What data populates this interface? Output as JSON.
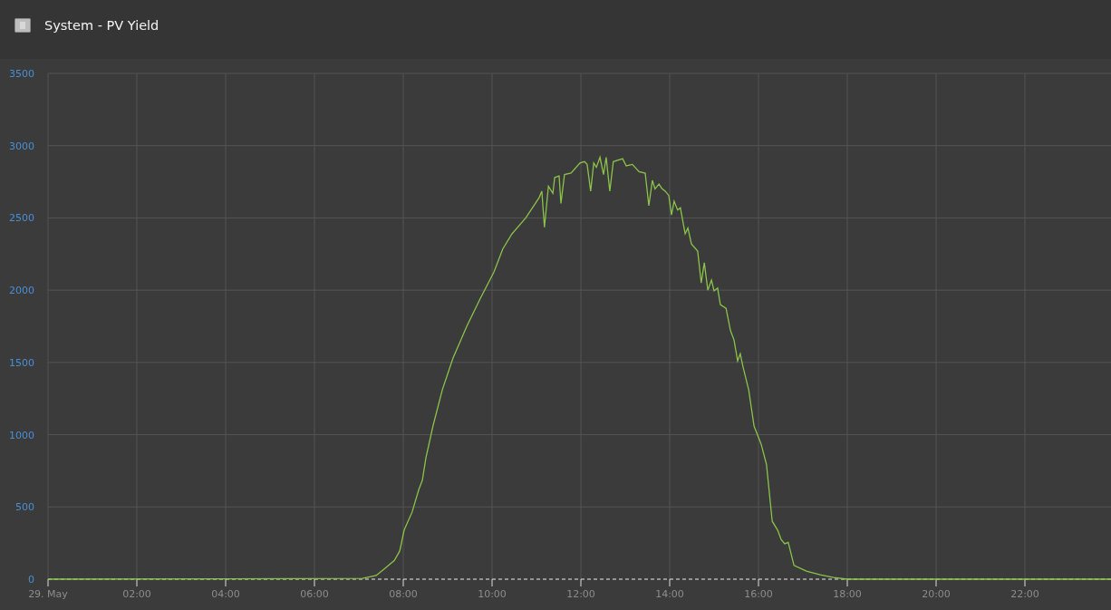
{
  "window": {
    "title": "System - PV Yield"
  },
  "chart": {
    "chart_data": {
      "type": "line",
      "xlim": [
        0,
        24
      ],
      "ylim": [
        0,
        3500
      ],
      "xticks": [
        {
          "value": 0,
          "label": "29. May"
        },
        {
          "value": 2,
          "label": "02:00"
        },
        {
          "value": 4,
          "label": "04:00"
        },
        {
          "value": 6,
          "label": "06:00"
        },
        {
          "value": 8,
          "label": "08:00"
        },
        {
          "value": 10,
          "label": "10:00"
        },
        {
          "value": 12,
          "label": "12:00"
        },
        {
          "value": 14,
          "label": "14:00"
        },
        {
          "value": 16,
          "label": "16:00"
        },
        {
          "value": 18,
          "label": "18:00"
        },
        {
          "value": 20,
          "label": "20:00"
        },
        {
          "value": 22,
          "label": "22:00"
        }
      ],
      "yticks": [
        0,
        500,
        1000,
        1500,
        2000,
        2500,
        3000,
        3500
      ],
      "x": [
        0,
        7.08,
        7.39,
        7.59,
        7.8,
        7.92,
        8.02,
        8.2,
        8.35,
        8.43,
        8.51,
        8.67,
        8.88,
        9.12,
        9.43,
        9.73,
        10.04,
        10.24,
        10.45,
        10.76,
        11.06,
        11.12,
        11.18,
        11.27,
        11.37,
        11.41,
        11.51,
        11.55,
        11.63,
        11.78,
        11.98,
        12.08,
        12.14,
        12.22,
        12.29,
        12.35,
        12.43,
        12.51,
        12.57,
        12.65,
        12.73,
        12.94,
        13.02,
        13.16,
        13.31,
        13.45,
        13.53,
        13.61,
        13.67,
        13.76,
        13.82,
        13.9,
        13.98,
        14.04,
        14.1,
        14.18,
        14.24,
        14.35,
        14.41,
        14.49,
        14.63,
        14.71,
        14.78,
        14.86,
        14.94,
        15,
        15.08,
        15.14,
        15.27,
        15.37,
        15.45,
        15.53,
        15.59,
        15.65,
        15.78,
        15.9,
        16.06,
        16.18,
        16.31,
        16.43,
        16.51,
        16.59,
        16.67,
        16.8,
        17.08,
        17.39,
        17.69,
        18,
        23.94
      ],
      "grid": true,
      "series": [
        {
          "color": "#8bc34a",
          "values": [
            0,
            5,
            25,
            75,
            130,
            195,
            340,
            465,
            620,
            685,
            840,
            1060,
            1310,
            1530,
            1750,
            1940,
            2125,
            2285,
            2390,
            2500,
            2640,
            2685,
            2435,
            2720,
            2670,
            2780,
            2790,
            2600,
            2800,
            2810,
            2880,
            2890,
            2870,
            2685,
            2880,
            2850,
            2920,
            2800,
            2920,
            2685,
            2890,
            2910,
            2860,
            2870,
            2820,
            2810,
            2585,
            2760,
            2700,
            2735,
            2705,
            2685,
            2655,
            2520,
            2615,
            2555,
            2570,
            2390,
            2430,
            2320,
            2270,
            2050,
            2190,
            2000,
            2070,
            1995,
            2015,
            1900,
            1875,
            1720,
            1655,
            1510,
            1560,
            1470,
            1310,
            1060,
            935,
            795,
            400,
            340,
            275,
            245,
            255,
            95,
            55,
            30,
            12,
            0,
            0
          ]
        }
      ]
    }
  }
}
